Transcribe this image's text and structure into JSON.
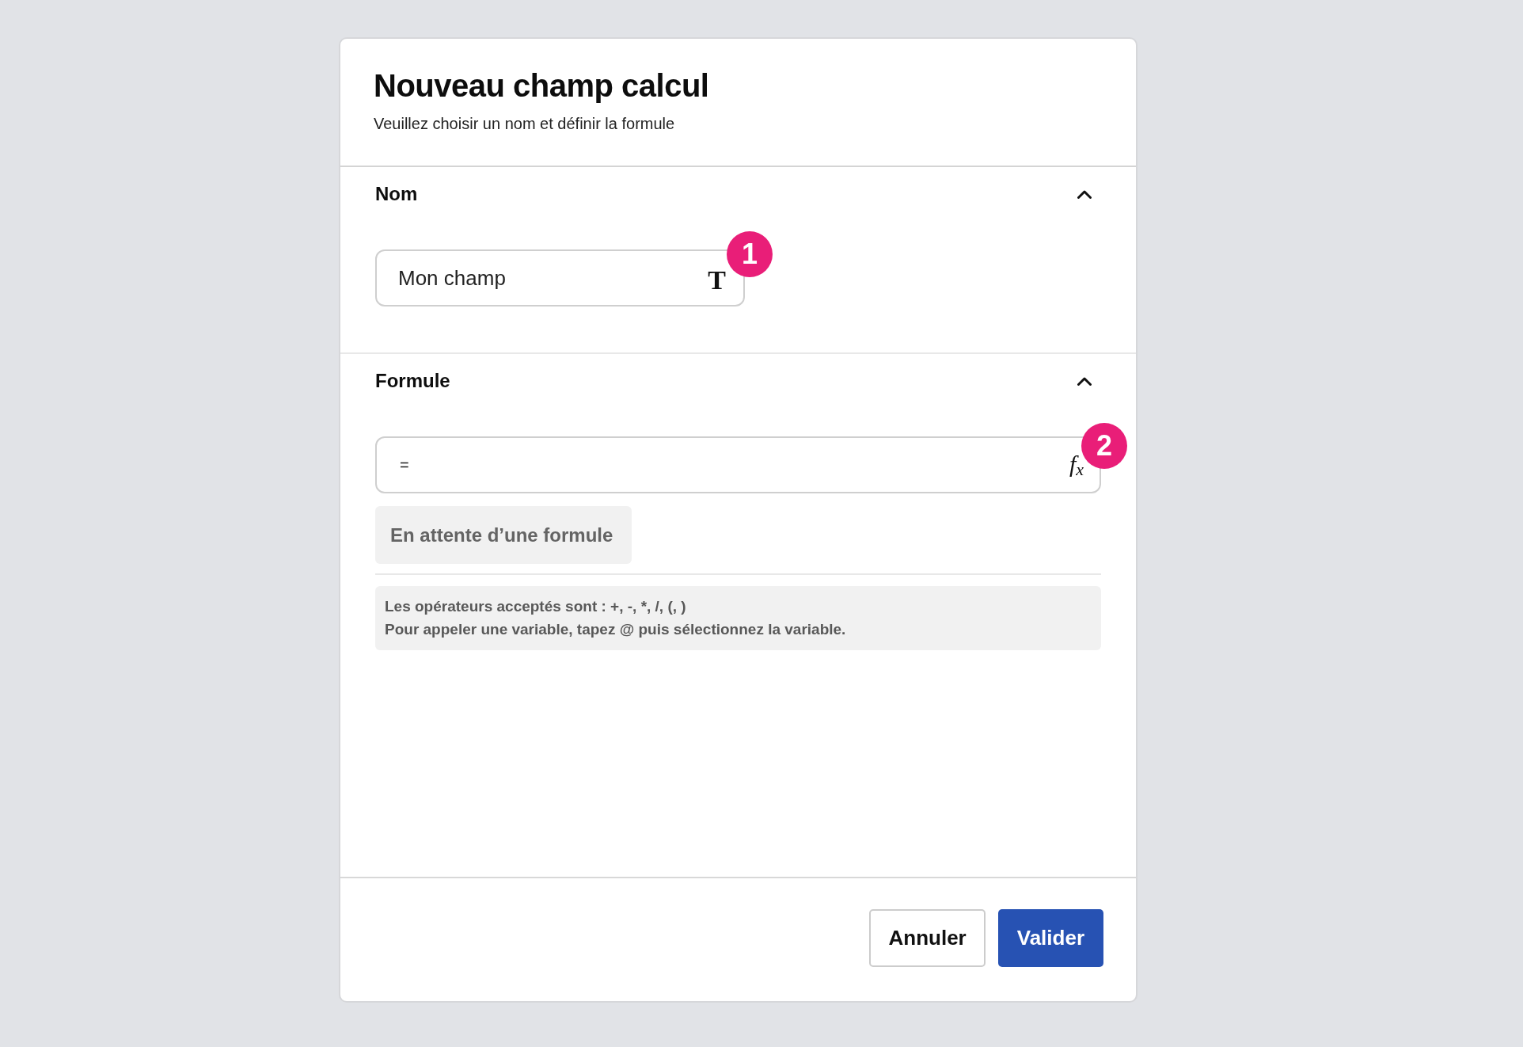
{
  "dialog": {
    "title": "Nouveau champ calcul",
    "subtitle": "Veuillez choisir un nom et définir la formule"
  },
  "sections": [
    {
      "kind": "text",
      "title": "Nom",
      "expanded": true,
      "value": "Mon champ",
      "symbol": "T",
      "marker": "1"
    },
    {
      "kind": "formula",
      "title": "Formule",
      "expanded": true,
      "value": "=",
      "symbol": "f$_{x}$",
      "marker": "2",
      "status": "En attente d’une formule",
      "help": [
        "Les opérateurs acceptés sont : +, -, *, /, (, )",
        "Pour appeler une variable, tapez @ puis sélectionnez la variable."
      ]
    }
  ],
  "buttons": [
    {
      "kind": "secondary",
      "label": "Annuler"
    },
    {
      "kind": "primary",
      "label": "Valider"
    }
  ]
}
